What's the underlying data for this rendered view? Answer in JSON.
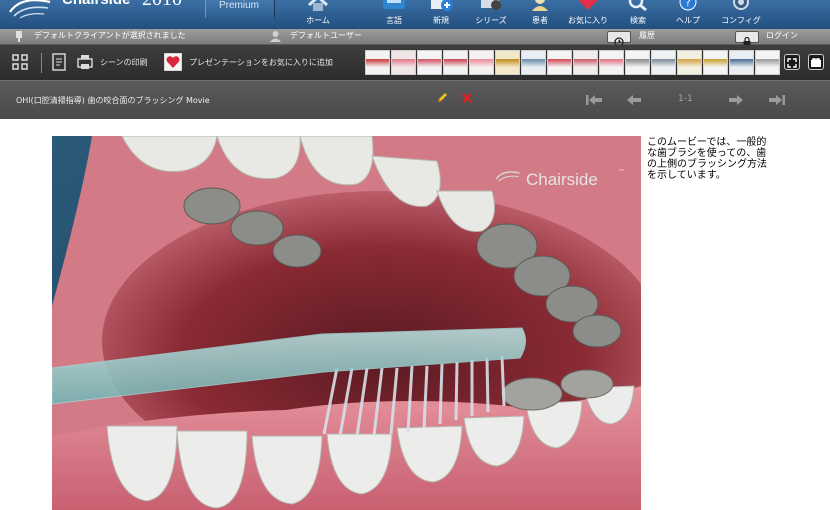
{
  "app": {
    "name": "Chairside",
    "trademark": "®",
    "year": "2010",
    "edition": "Premium"
  },
  "nav": [
    {
      "label": "ホーム",
      "icon": "home-icon"
    },
    {
      "label": "言語",
      "icon": "language-icon"
    },
    {
      "label": "新規",
      "icon": "new-icon"
    },
    {
      "label": "シリーズ",
      "icon": "series-icon"
    },
    {
      "label": "患者",
      "icon": "patient-icon"
    },
    {
      "label": "お気に入り",
      "icon": "favorites-icon"
    },
    {
      "label": "検索",
      "icon": "search-icon"
    },
    {
      "label": "ヘルプ",
      "icon": "help-icon"
    },
    {
      "label": "コンフィグ",
      "icon": "config-icon"
    }
  ],
  "status": {
    "client": "デフォルトクライアントが選択されました",
    "user": "デフォルトユーザー",
    "history": "履歴",
    "login": "ログイン"
  },
  "toolbar": {
    "print_scene": "シーンの印刷",
    "add_favorite": "プレゼンテーションをお気に入りに追加",
    "thumb_count": 16
  },
  "movie_bar": {
    "title": "OHI(口腔清掃指導) 歯の咬合面のブラッシング Movie",
    "page": "1-1"
  },
  "movie": {
    "watermark": "Chairside",
    "watermark_tm": "™"
  },
  "description": "このムービーでは、一般的な歯ブラシを使っての、歯の上側のブラッシング方法を示しています。",
  "colors": {
    "header_blue": "#2b5c8f",
    "status_gray": "#8a8a8a",
    "toolbar_dark": "#333333",
    "edit_yellow": "#f0c020",
    "delete_red": "#e02020"
  }
}
